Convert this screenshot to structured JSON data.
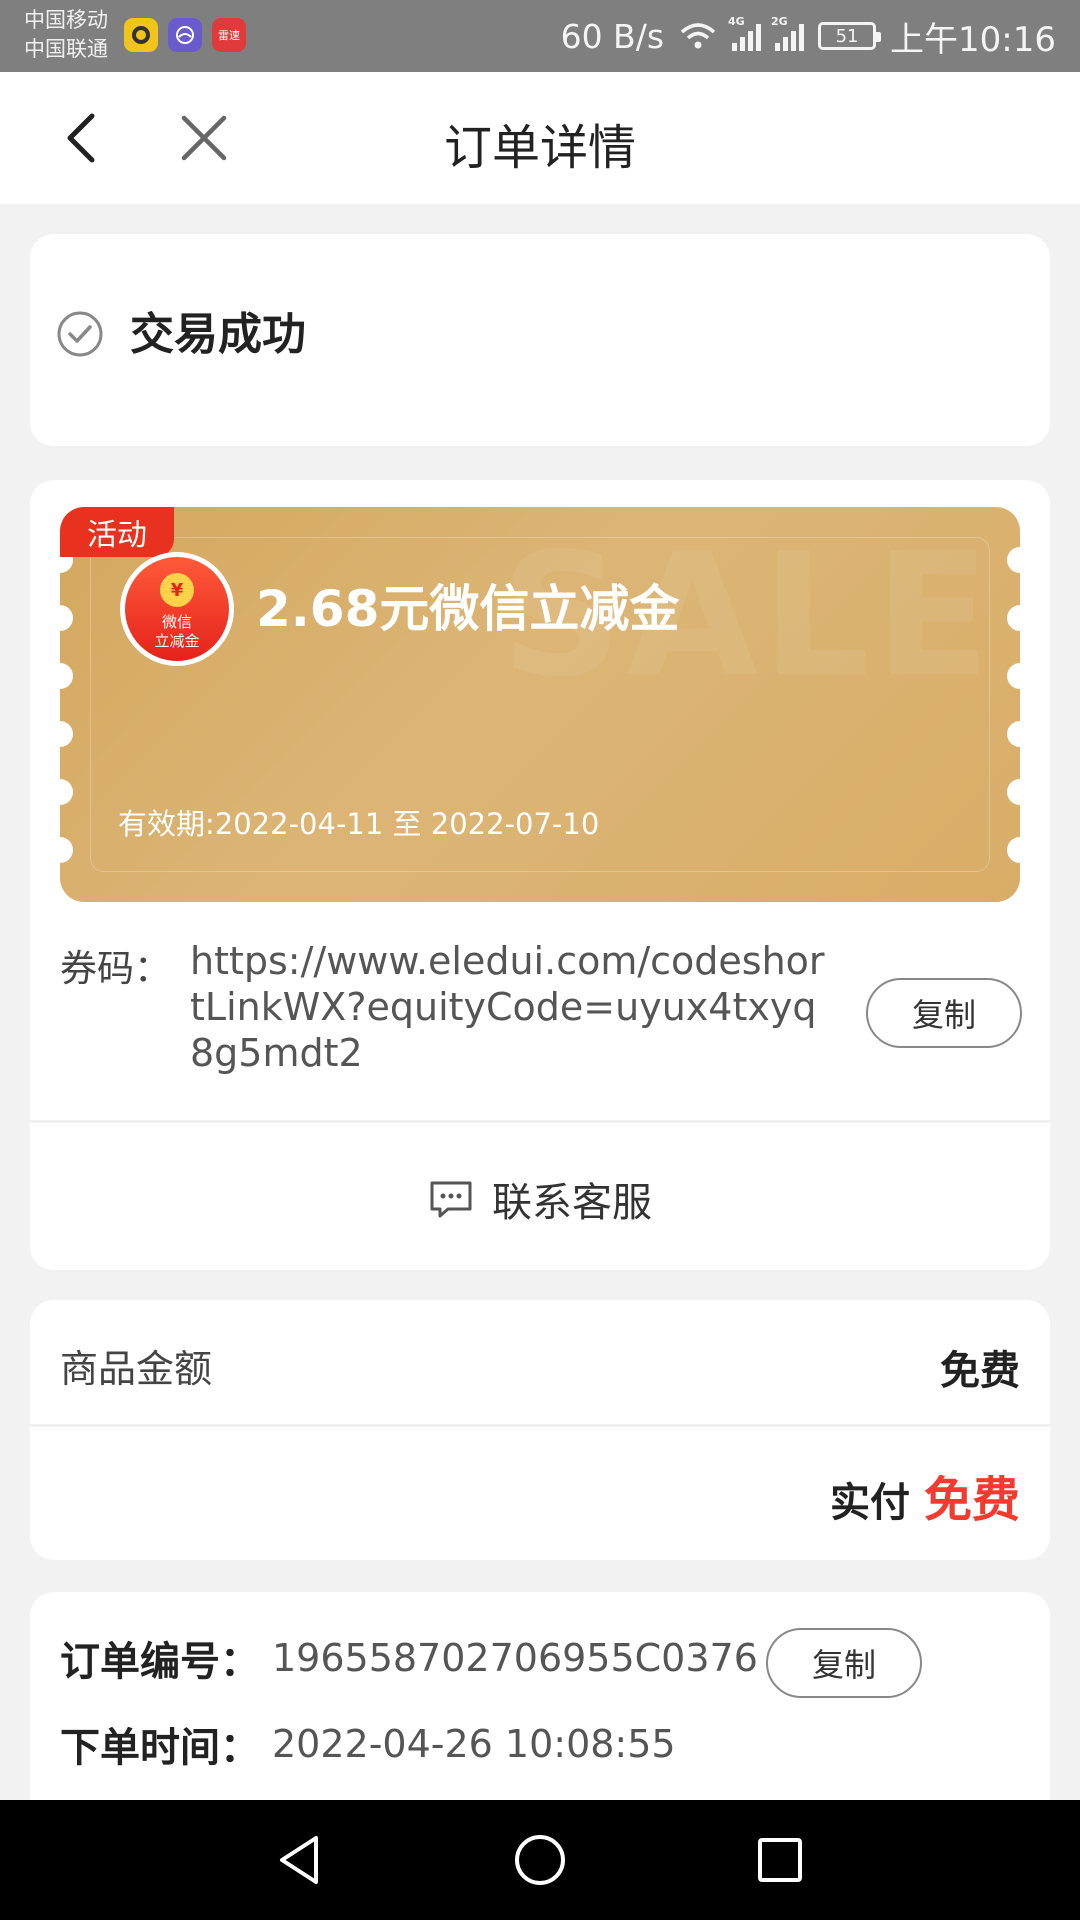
{
  "status_bar": {
    "carrier_1": "中国移动",
    "carrier_2": "中国联通",
    "app_badge_3": "雷速",
    "net_speed": "60 B/s",
    "signal_1_tag": "4G",
    "signal_2_tag": "2G",
    "battery": "51",
    "time": "上午10:16"
  },
  "nav": {
    "title": "订单详情"
  },
  "order_status": {
    "text": "交易成功"
  },
  "voucher": {
    "activity_tag": "活动",
    "redpack_coin": "¥",
    "redpack_line1": "微信",
    "redpack_line2": "立减金",
    "background_text": "SALE",
    "title": "2.68元微信立减金",
    "validity": "有效期:2022-04-11 至 2022-07-10",
    "code_label": "券码：",
    "code_value": "https://www.eledui.com/codeshortLinkWX?equityCode=uyux4txyq8g5mdt2",
    "copy_label": "复制",
    "contact_label": "联系客服"
  },
  "price": {
    "goods_label": "商品金额",
    "goods_value": "免费",
    "paid_label": "实付",
    "paid_value": "免费",
    "accent_color": "#f23a2f"
  },
  "order_info": {
    "number_label": "订单编号：",
    "number_value": "196558702706955C0376",
    "copy_label": "复制",
    "time_label": "下单时间：",
    "time_value": "2022-04-26 10:08:55"
  }
}
